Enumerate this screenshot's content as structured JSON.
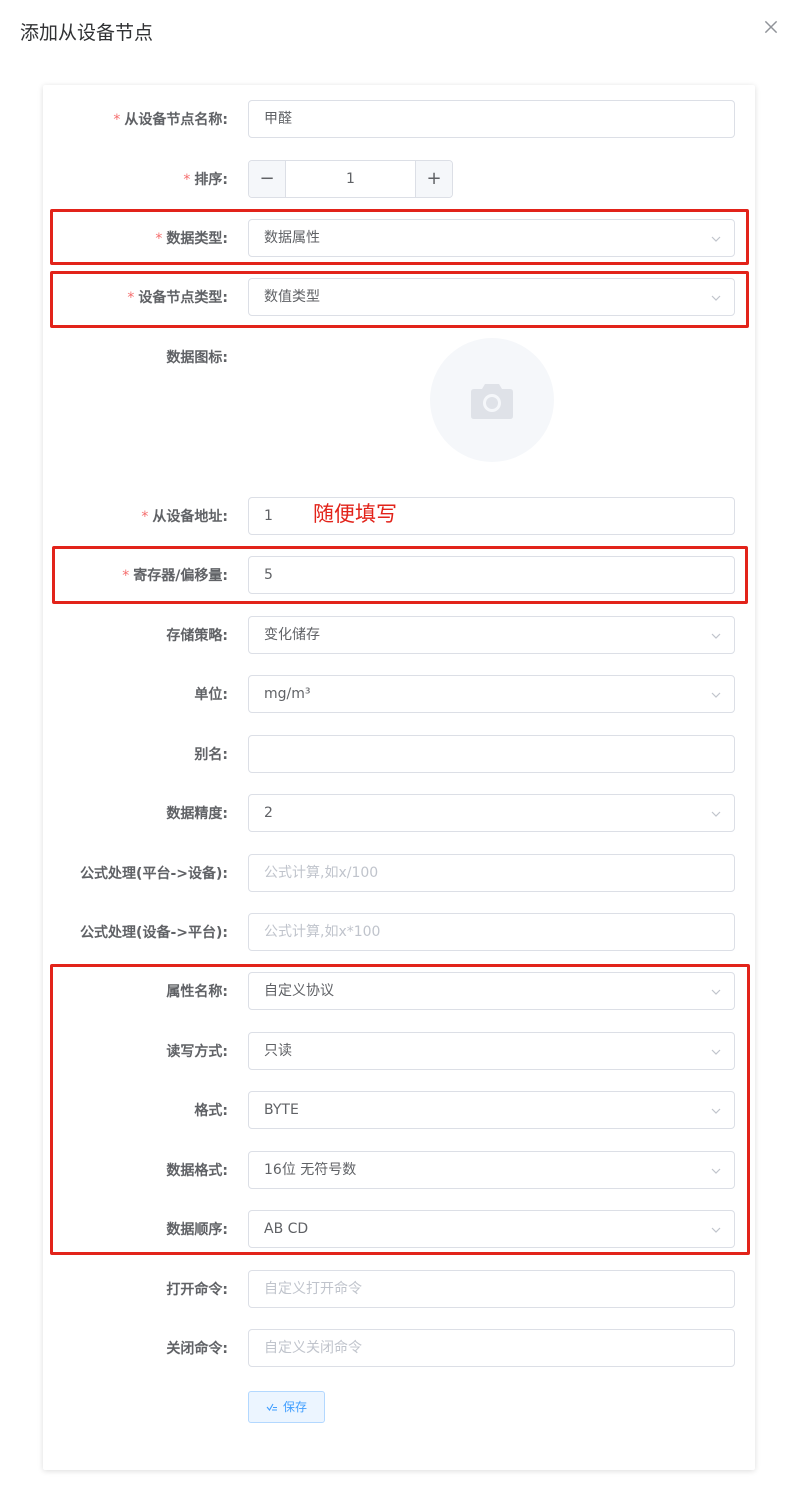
{
  "dialog": {
    "title": "添加从设备节点"
  },
  "form": {
    "name": {
      "label": "从设备节点名称:",
      "value": "甲醛",
      "required": true
    },
    "sort": {
      "label": "排序:",
      "value": "1",
      "minus": "−",
      "plus": "+",
      "required": true
    },
    "data_type": {
      "label": "数据类型:",
      "value": "数据属性",
      "required": true
    },
    "node_type": {
      "label": "设备节点类型:",
      "value": "数值类型",
      "required": true
    },
    "icon": {
      "label": "数据图标:"
    },
    "address": {
      "label": "从设备地址:",
      "value": "1",
      "hint": "随便填写",
      "required": true
    },
    "register": {
      "label": "寄存器/偏移量:",
      "value": "5",
      "required": true
    },
    "storage": {
      "label": "存储策略:",
      "value": "变化储存"
    },
    "unit": {
      "label": "单位:",
      "value": "mg/m³"
    },
    "alias": {
      "label": "别名:",
      "value": ""
    },
    "precision": {
      "label": "数据精度:",
      "value": "2"
    },
    "formula_up": {
      "label": "公式处理(平台->设备):",
      "placeholder": "公式计算,如x/100"
    },
    "formula_down": {
      "label": "公式处理(设备->平台):",
      "placeholder": "公式计算,如x*100"
    },
    "attr_name": {
      "label": "属性名称:",
      "value": "自定义协议"
    },
    "rw_mode": {
      "label": "读写方式:",
      "value": "只读"
    },
    "format": {
      "label": "格式:",
      "value": "BYTE"
    },
    "data_format": {
      "label": "数据格式:",
      "value": "16位 无符号数"
    },
    "data_order": {
      "label": "数据顺序:",
      "value": "AB CD"
    },
    "open_cmd": {
      "label": "打开命令:",
      "placeholder": "自定义打开命令"
    },
    "close_cmd": {
      "label": "关闭命令:",
      "placeholder": "自定义关闭命令"
    },
    "required_mark": "*",
    "save_label": "保存"
  },
  "colors": {
    "highlight": "#e2231a",
    "primary": "#409eff",
    "required": "#f56c6c"
  }
}
